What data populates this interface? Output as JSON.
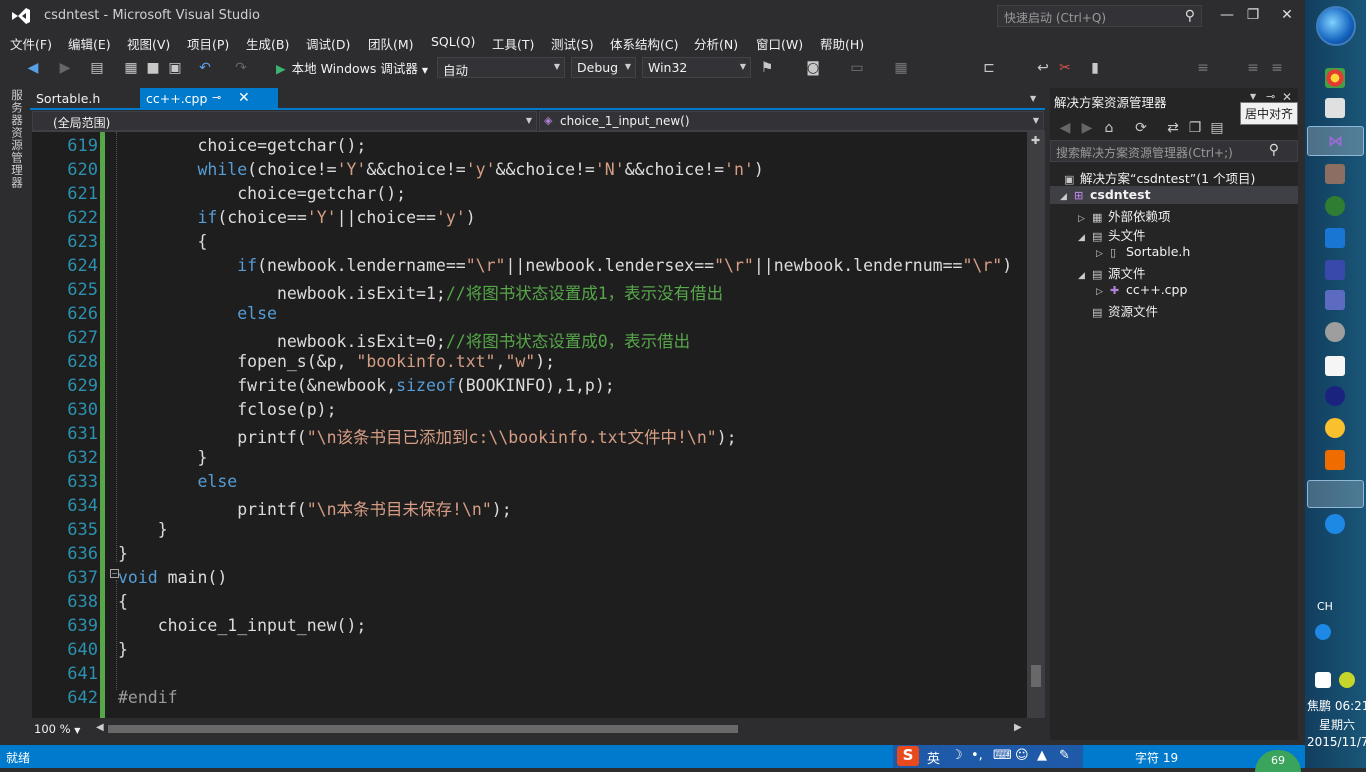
{
  "window": {
    "title": "csdntest - Microsoft Visual Studio",
    "quick_launch_placeholder": "快速启动 (Ctrl+Q)",
    "minimize": "—",
    "restore": "❐",
    "close": "✕"
  },
  "menu": [
    "文件(F)",
    "编辑(E)",
    "视图(V)",
    "项目(P)",
    "生成(B)",
    "调试(D)",
    "团队(M)",
    "SQL(Q)",
    "工具(T)",
    "测试(S)",
    "体系结构(C)",
    "分析(N)",
    "窗口(W)",
    "帮助(H)"
  ],
  "toolbar": {
    "run_label": "本地 Windows 调试器",
    "config_auto": "自动",
    "config": "Debug",
    "platform": "Win32"
  },
  "left_tab": "服务器资源管理器",
  "tabs": {
    "tab1": "Sortable.h",
    "tab2": "cc++.cpp",
    "pin": "⊸",
    "close": "✕"
  },
  "nav": {
    "scope": "(全局范围)",
    "function": "choice_1_input_new()"
  },
  "editor": {
    "line_numbers": [
      "619",
      "620",
      "621",
      "622",
      "623",
      "624",
      "625",
      "626",
      "627",
      "628",
      "629",
      "630",
      "631",
      "632",
      "633",
      "634",
      "635",
      "636",
      "637",
      "638",
      "639",
      "640",
      "641",
      "642"
    ],
    "zoom": "100 %"
  },
  "solution": {
    "title": "解决方案资源管理器",
    "tooltip": "居中对齐",
    "search_placeholder": "搜索解决方案资源管理器(Ctrl+;)",
    "solution_label": "解决方案“csdntest”(1 个项目)",
    "project": "csdntest",
    "external": "外部依赖项",
    "headers": "头文件",
    "header_file": "Sortable.h",
    "sources": "源文件",
    "source_file": "cc++.cpp",
    "resources": "资源文件"
  },
  "status": {
    "ready": "就绪",
    "ime_lang": "英",
    "char": "字符 19",
    "badge": "69"
  },
  "taskbar": {
    "lang": "CH",
    "time": "焦鹏 06:21",
    "day": "星期六",
    "date": "2015/11/7"
  },
  "colors": {
    "accent": "#007acc",
    "keyword": "#569cd6",
    "string": "#d69d85",
    "comment": "#57a64a",
    "line_number": "#2b91af"
  }
}
